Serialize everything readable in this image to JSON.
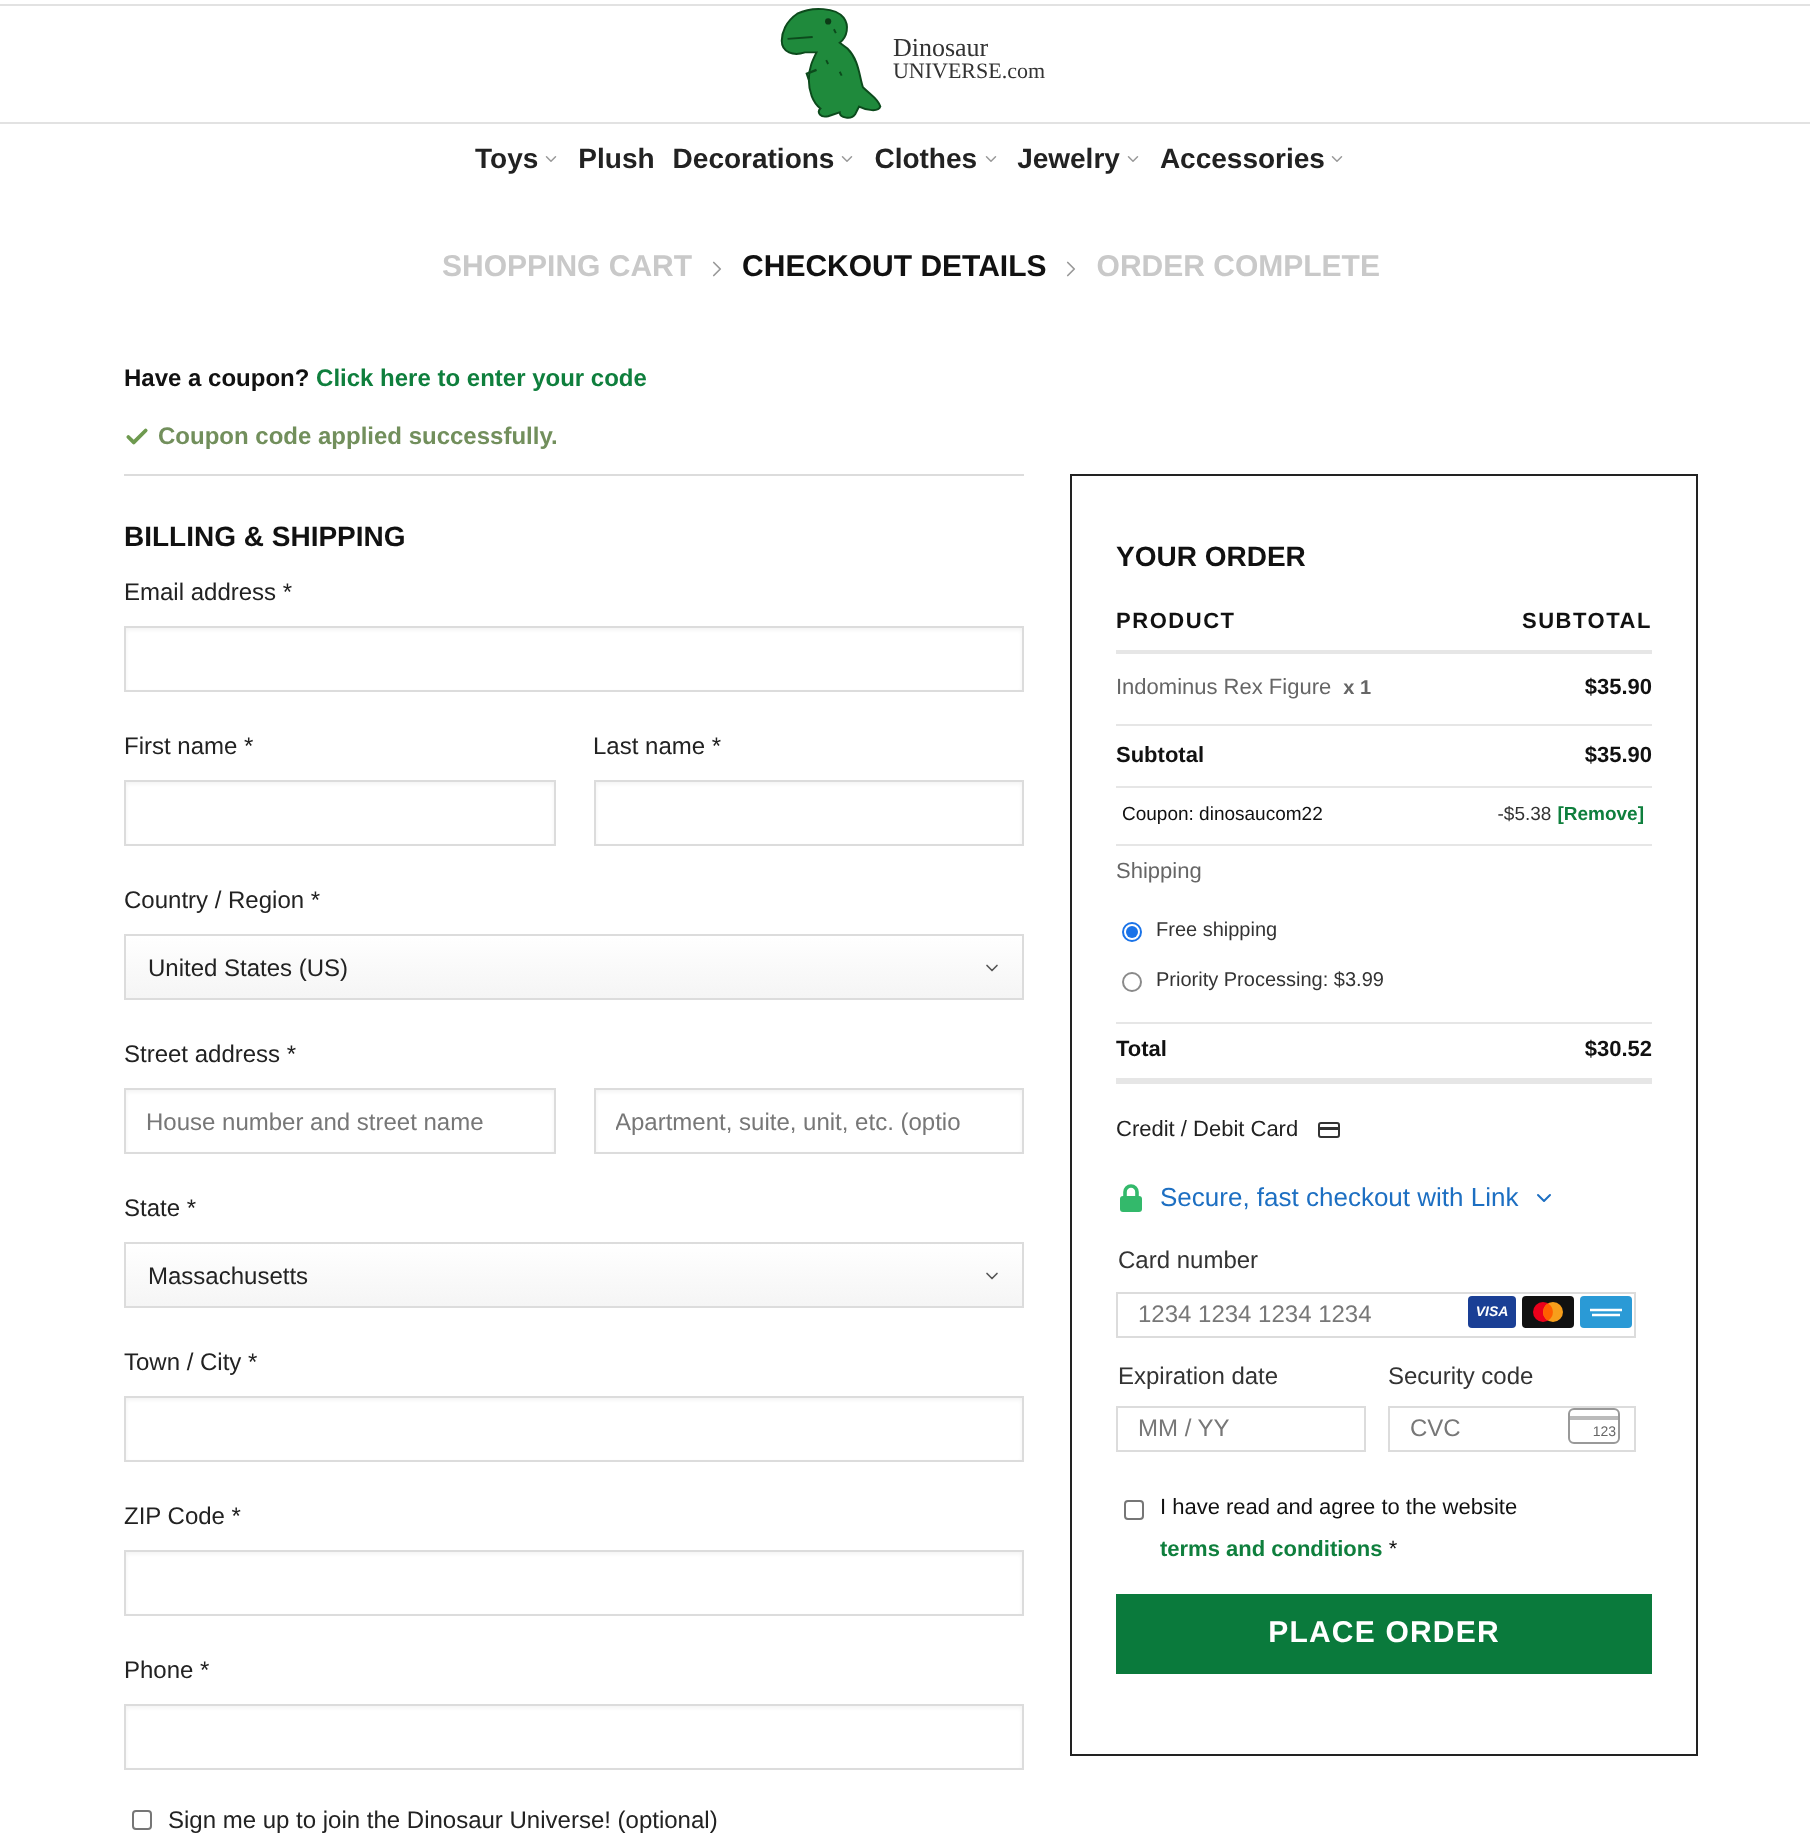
{
  "header": {
    "logo": {
      "title": "Dinosaur",
      "subtitle": "UNIVERSE.com"
    }
  },
  "nav": [
    {
      "label": "Toys",
      "has_menu": true
    },
    {
      "label": "Plush",
      "has_menu": false
    },
    {
      "label": "Decorations",
      "has_menu": true
    },
    {
      "label": "Clothes",
      "has_menu": true
    },
    {
      "label": "Jewelry",
      "has_menu": true
    },
    {
      "label": "Accessories",
      "has_menu": true
    }
  ],
  "steps": [
    {
      "label": "SHOPPING CART",
      "selected": false
    },
    {
      "label": "CHECKOUT DETAILS",
      "selected": true
    },
    {
      "label": "ORDER COMPLETE",
      "selected": false
    }
  ],
  "coupon": {
    "prompt": "Have a coupon?",
    "link": "Click here to enter your code",
    "notice": "Coupon code applied successfully."
  },
  "billing": {
    "title": "BILLING & SHIPPING",
    "rows": [
      {
        "fields": [
          {
            "kind": "input",
            "label": "Email address *"
          }
        ]
      },
      {
        "fields": [
          {
            "kind": "input",
            "label": "First name *"
          },
          {
            "kind": "input",
            "label": "Last name *"
          }
        ]
      },
      {
        "fields": [
          {
            "kind": "select",
            "label": "Country / Region *",
            "value": "United States (US)"
          }
        ]
      },
      {
        "fields": [
          {
            "kind": "input",
            "label": "Street address *",
            "placeholder": "House number and street name"
          },
          {
            "kind": "input",
            "placeholder": "Apartment, suite, unit, etc. (optio"
          }
        ]
      },
      {
        "fields": [
          {
            "kind": "select",
            "label": "State *",
            "value": "Massachusetts"
          }
        ]
      },
      {
        "fields": [
          {
            "kind": "input",
            "label": "Town / City *"
          }
        ]
      },
      {
        "fields": [
          {
            "kind": "input",
            "label": "ZIP Code *"
          }
        ]
      },
      {
        "fields": [
          {
            "kind": "input",
            "label": "Phone *"
          }
        ]
      }
    ],
    "newsletter": {
      "label": "Sign me up to join the Dinosaur Universe! (optional)",
      "checked": false
    }
  },
  "order": {
    "title": "YOUR ORDER",
    "columns": [
      "PRODUCT",
      "SUBTOTAL"
    ],
    "items": [
      {
        "name": "Indominus Rex Figure",
        "quantity": "x 1",
        "price": "$35.90"
      }
    ],
    "subtotal": {
      "label": "Subtotal",
      "value": "$35.90"
    },
    "coupon": {
      "label": "Coupon: dinosaucom22",
      "value": "-$5.38",
      "action": "[Remove]"
    },
    "shipping": {
      "label": "Shipping",
      "options": [
        {
          "label": "Free shipping",
          "selected": true
        },
        {
          "label": "Priority Processing: $3.99",
          "selected": false
        }
      ]
    },
    "total": {
      "label": "Total",
      "value": "$30.52"
    }
  },
  "payment": {
    "method": "Credit / Debit Card",
    "link_offer": "Secure, fast checkout with Link",
    "card_number": {
      "label": "Card number",
      "placeholder": "1234 1234 1234 1234",
      "brands": [
        {
          "kind": "visa",
          "text": "VISA"
        },
        {
          "kind": "mastercard"
        },
        {
          "kind": "amex"
        }
      ]
    },
    "expiry": {
      "label": "Expiration date",
      "placeholder": "MM / YY"
    },
    "cvc": {
      "label": "Security code",
      "placeholder": "CVC",
      "icon_text": "123"
    }
  },
  "terms": {
    "text": "I have read and agree to the website",
    "link": "terms and conditions",
    "suffix": "*",
    "checked": false
  },
  "place_order": {
    "label": "PLACE ORDER"
  }
}
